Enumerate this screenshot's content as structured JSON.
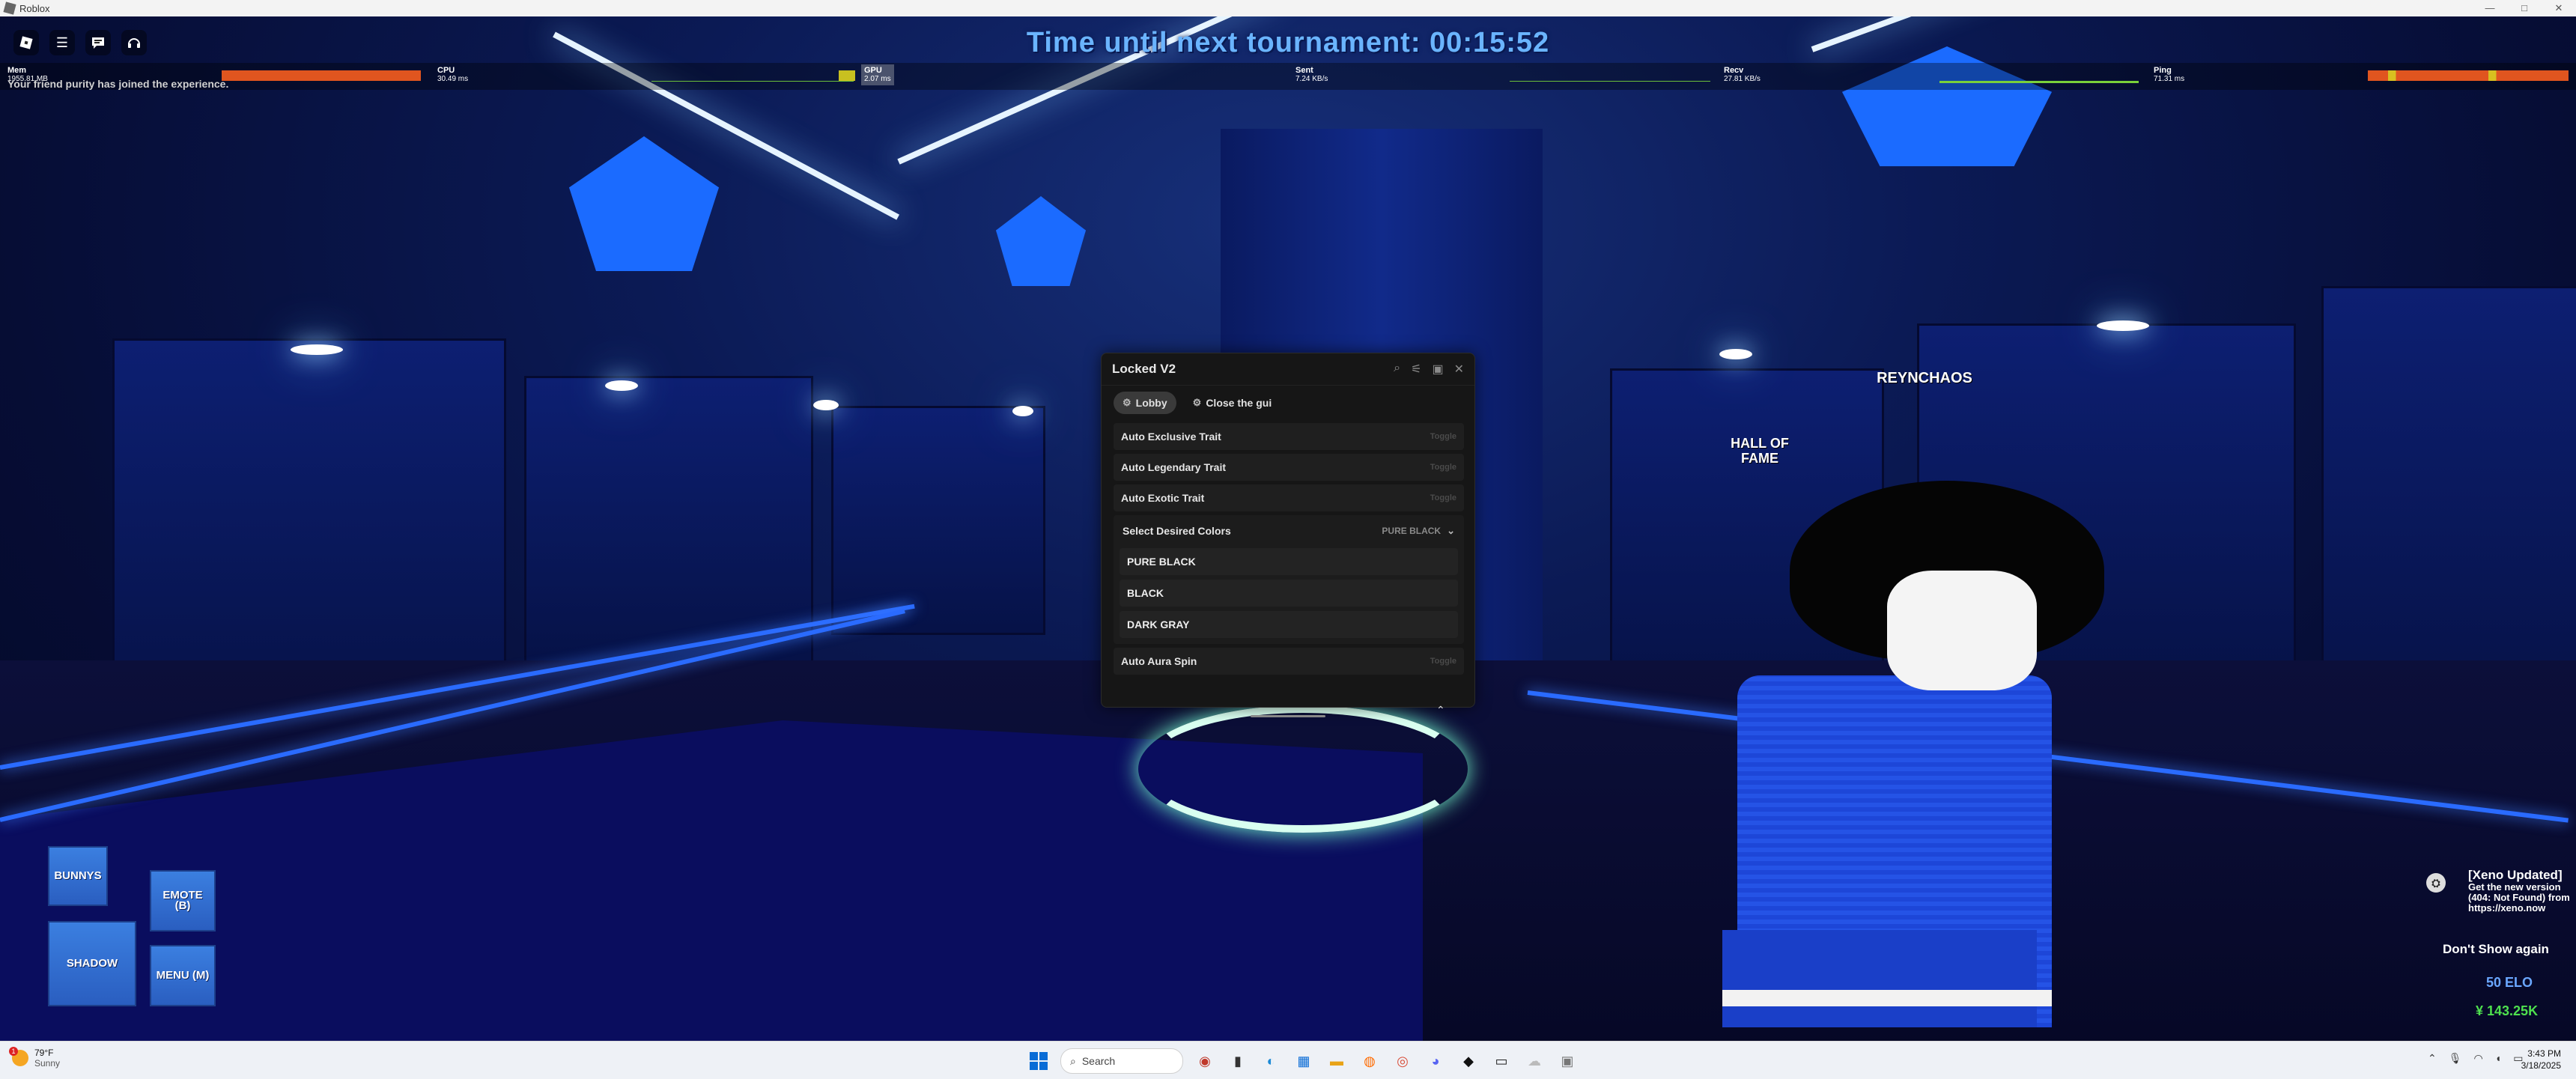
{
  "window": {
    "title": "Roblox",
    "controls": [
      "—",
      "□",
      "✕"
    ]
  },
  "hud": {
    "tournament": "Time until next tournament: 00:15:52",
    "system_message": "Your friend purity has joined the experience.",
    "stats": [
      {
        "label": "Mem",
        "value": "1955.81 MB"
      },
      {
        "label": "CPU",
        "value": "30.49 ms"
      },
      {
        "label": "GPU",
        "value": "2.07 ms"
      },
      {
        "label": "Sent",
        "value": "7.24 KB/s"
      },
      {
        "label": "Recv",
        "value": "27.81 KB/s"
      },
      {
        "label": "Ping",
        "value": "71.31 ms"
      }
    ]
  },
  "world": {
    "player_name": "REYNCHAOS",
    "hall_of_fame": "HALL OF FAME"
  },
  "gui": {
    "title": "Locked V2",
    "tabs": [
      {
        "label": "Lobby",
        "active": true
      },
      {
        "label": "Close the gui",
        "active": false
      }
    ],
    "toggles": [
      {
        "label": "Auto Exclusive Trait",
        "state": "Toggle"
      },
      {
        "label": "Auto Legendary Trait",
        "state": "Toggle"
      },
      {
        "label": "Auto Exotic Trait",
        "state": "Toggle"
      }
    ],
    "dropdown": {
      "label": "Select Desired Colors",
      "selected": "PURE BLACK",
      "options": [
        "PURE BLACK",
        "BLACK",
        "DARK GRAY"
      ]
    },
    "toggle_after": {
      "label": "Auto Aura Spin",
      "state": "Toggle"
    }
  },
  "game_buttons": {
    "bunnys": "BUNNYS",
    "emote": "EMOTE (B)",
    "shadow": "SHADOW",
    "menu": "MENU (M)"
  },
  "notification": {
    "title": "[Xeno Updated]",
    "body": "Get the new version (404: Not Found) from https://xeno.now",
    "dismiss": "Don't Show again"
  },
  "currency": {
    "elo": "50 ELO",
    "money": "¥ 143.25K"
  },
  "taskbar": {
    "weather_temp": "79°F",
    "weather_desc": "Sunny",
    "weather_badge": "1",
    "search_placeholder": "Search",
    "time": "3:43 PM",
    "date": "3/18/2025"
  },
  "colors": {
    "accent_blue": "#6ab4ff",
    "money_green": "#4ee04e",
    "elo_blue": "#6aa7ff",
    "button_blue": "#3b7fe0"
  }
}
